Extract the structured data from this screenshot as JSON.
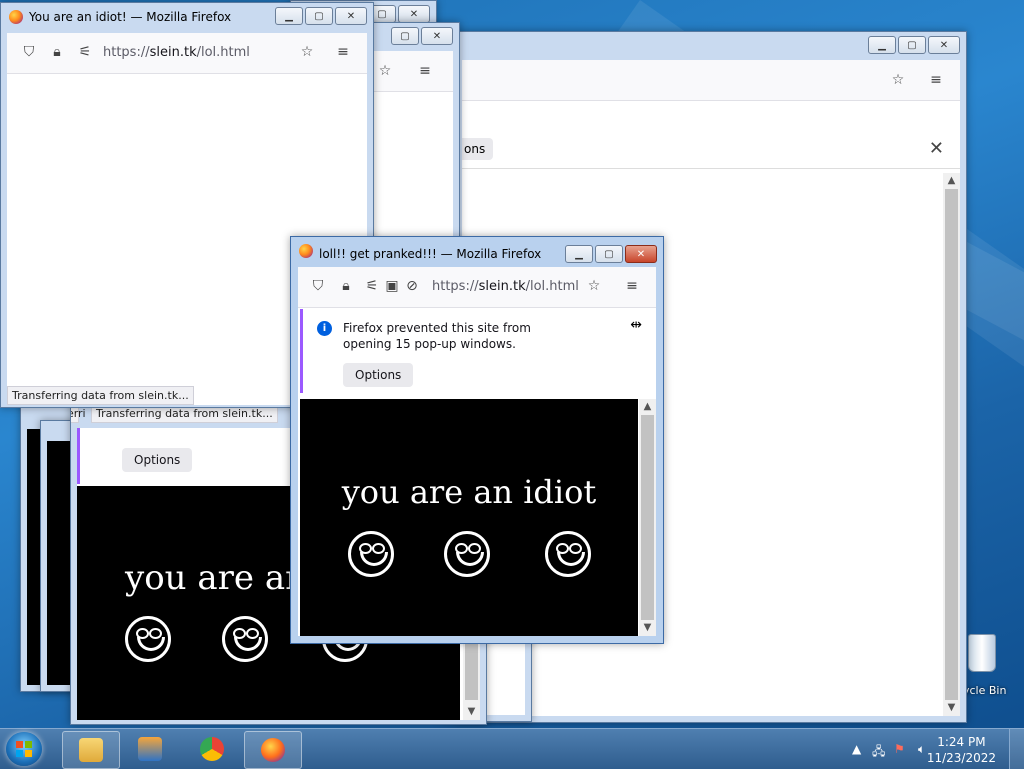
{
  "colors": {
    "accent": "#0060df",
    "notification_bar": "#9b59ff",
    "close_button": "#c8452b"
  },
  "windows": {
    "back_large": {
      "tab_fragment": "ons"
    },
    "top_left": {
      "title": "You are an idiot! — Mozilla Firefox",
      "url_prefix": "https://",
      "url_host": "slein.tk",
      "url_path": "/lol.html",
      "status": "Transferring data from slein.tk..."
    },
    "bottom_left": {
      "status_front": "Transferring data from slein.tk...",
      "status_back": "Transferri",
      "options_label": "Options",
      "idiot_text": "you are an"
    },
    "popup": {
      "title": "loll!! get pranked!!! — Mozilla Firefox",
      "url_prefix": "https://",
      "url_host": "slein.tk",
      "url_path": "/lol.html",
      "notification": "Firefox prevented this site from opening 15 pop-up windows.",
      "options_label": "Options",
      "idiot_text": "you are an idiot"
    }
  },
  "icons": [
    "shield-icon",
    "lock-icon",
    "permissions-icon",
    "star-icon",
    "menu-icon",
    "info-icon",
    "close-icon",
    "smiley-icon",
    "resize-cursor-icon"
  ],
  "desktop": {
    "recycle_bin_label": "ycle Bin"
  },
  "taskbar": {
    "items": [
      "Windows Explorer",
      "Windows Media Player",
      "Google Chrome",
      "Mozilla Firefox"
    ],
    "time": "1:24 PM",
    "date": "11/23/2022"
  }
}
